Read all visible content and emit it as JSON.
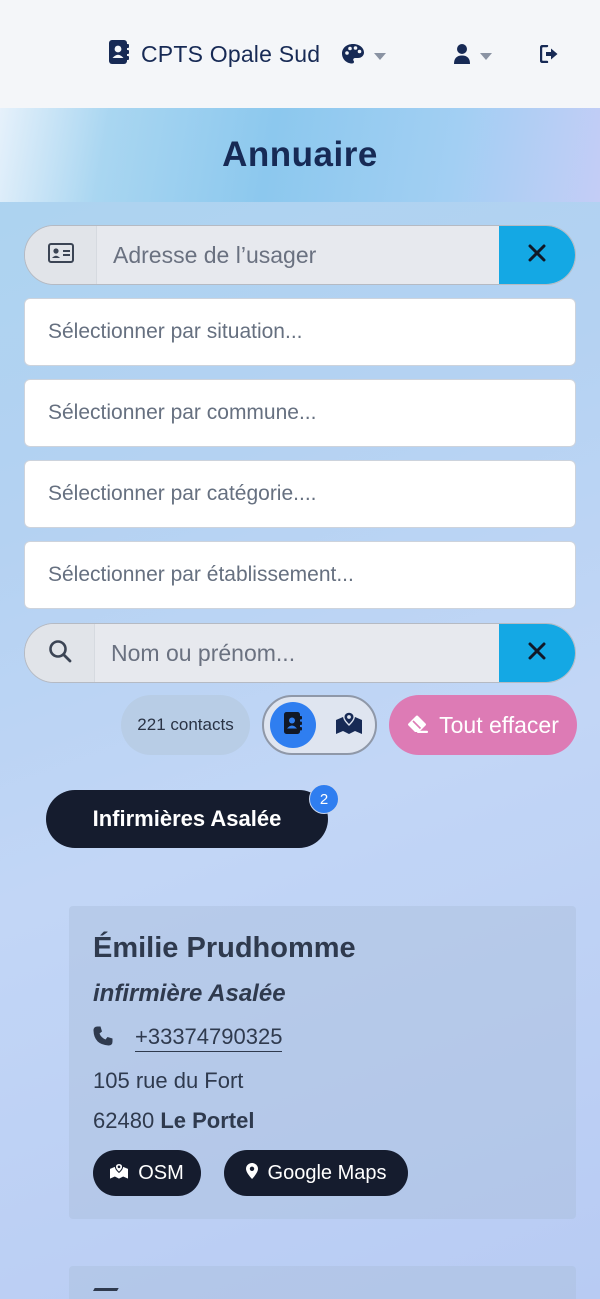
{
  "navbar": {
    "brand_title": "CPTS Opale Sud"
  },
  "hero": {
    "title": "Annuaire"
  },
  "address_search": {
    "placeholder": "Adresse de l’usager"
  },
  "filters": {
    "situation": "Sélectionner par situation...",
    "commune": "Sélectionner par commune...",
    "categorie": "Sélectionner par catégorie....",
    "etablissement": "Sélectionner par établissement..."
  },
  "name_search": {
    "placeholder": "Nom ou prénom..."
  },
  "toolbar": {
    "contact_count": "221 contacts",
    "clear_all_label": "Tout effacer"
  },
  "category": {
    "label": "Infirmières Asalée",
    "count": "2"
  },
  "contacts": [
    {
      "name": "Émilie Prudhomme",
      "role": "infirmière Asalée",
      "phone": "+33374790325",
      "street": "105 rue du Fort",
      "postcode": "62480",
      "city": "Le Portel",
      "osm_label": "OSM",
      "gmaps_label": "Google Maps"
    }
  ],
  "colors": {
    "accent_blue": "#14a8e4",
    "active_toggle": "#2f7ef0",
    "clear_pink": "#dd7bb5",
    "dark_navy": "#151c2e",
    "brand_navy": "#172a55"
  }
}
